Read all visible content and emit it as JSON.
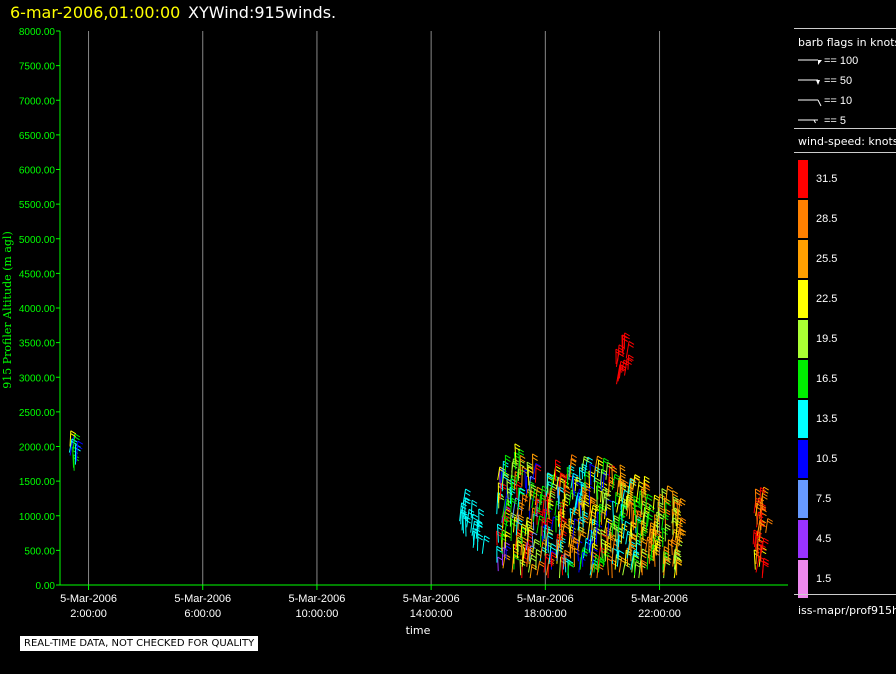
{
  "title": {
    "date": "6-mar-2006,01:00:00",
    "main": "XYWind:915winds."
  },
  "footer": {
    "quality_notice": "REAL-TIME DATA, NOT CHECKED FOR QUALITY",
    "source": "iss-mapr/prof915h"
  },
  "legend": {
    "barb_title": "barb flags in knots",
    "barbs": [
      {
        "label": "== 100",
        "kind": "flag-100"
      },
      {
        "label": "== 50",
        "kind": "flag-50"
      },
      {
        "label": "== 10",
        "kind": "barb-10"
      },
      {
        "label": "== 5",
        "kind": "barb-5"
      }
    ],
    "speed_title": "wind-speed: knots",
    "speed_scale": [
      {
        "label": "31.5",
        "color": "#ff0000"
      },
      {
        "label": "28.5",
        "color": "#ff8000"
      },
      {
        "label": "25.5",
        "color": "#ff9f00"
      },
      {
        "label": "22.5",
        "color": "#ffff00"
      },
      {
        "label": "19.5",
        "color": "#aaff33"
      },
      {
        "label": "16.5",
        "color": "#00ee00"
      },
      {
        "label": "13.5",
        "color": "#00ffff"
      },
      {
        "label": "10.5",
        "color": "#0000ff"
      },
      {
        "label": "7.5",
        "color": "#6699ff"
      },
      {
        "label": "4.5",
        "color": "#9933ff"
      },
      {
        "label": "1.5",
        "color": "#ee88ee"
      }
    ]
  },
  "colors": {
    "axis": "#00ff00",
    "grid": "#888888",
    "background": "#000000"
  },
  "chart_data": {
    "type": "scatter",
    "xlabel": "time",
    "ylabel": "915 Profiler Altitude (m agl)",
    "xlim_hours": [
      1.0,
      26.5
    ],
    "ylim": [
      0,
      8000
    ],
    "y_ticks": [
      "0.00",
      "500.00",
      "1000.00",
      "1500.00",
      "2000.00",
      "2500.00",
      "3000.00",
      "3500.00",
      "4000.00",
      "4500.00",
      "5000.00",
      "5500.00",
      "6000.00",
      "6500.00",
      "7000.00",
      "7500.00",
      "8000.00"
    ],
    "x_ticks": [
      {
        "hour": 2,
        "date": "5-Mar-2006",
        "time": "2:00:00"
      },
      {
        "hour": 6,
        "date": "5-Mar-2006",
        "time": "6:00:00"
      },
      {
        "hour": 10,
        "date": "5-Mar-2006",
        "time": "10:00:00"
      },
      {
        "hour": 14,
        "date": "5-Mar-2006",
        "time": "14:00:00"
      },
      {
        "hour": 18,
        "date": "5-Mar-2006",
        "time": "18:00:00"
      },
      {
        "hour": 22,
        "date": "5-Mar-2006",
        "time": "22:00:00"
      }
    ],
    "grid": true,
    "series": [
      {
        "time_hours": 1.5,
        "alt_range": [
          1650,
          2000
        ],
        "speeds": [
          10,
          12,
          14,
          16,
          20,
          23
        ]
      },
      {
        "time_hours": 15.2,
        "alt_range": [
          700,
          1100
        ],
        "speeds": [
          13,
          14
        ]
      },
      {
        "time_hours": 15.6,
        "alt_range": [
          450,
          800
        ],
        "speeds": [
          13,
          14
        ]
      },
      {
        "time_hours": 16.5,
        "alt_range": [
          200,
          1600
        ],
        "speeds": [
          5,
          10,
          13,
          17,
          20,
          23,
          26,
          30
        ]
      },
      {
        "time_hours": 17.0,
        "alt_range": [
          100,
          1750
        ],
        "speeds": [
          8,
          13,
          16,
          19,
          22,
          26,
          29,
          32
        ]
      },
      {
        "time_hours": 17.5,
        "alt_range": [
          100,
          1600
        ],
        "speeds": [
          8,
          11,
          15,
          19,
          22,
          25,
          28,
          32
        ]
      },
      {
        "time_hours": 18.0,
        "alt_range": [
          100,
          1400
        ],
        "speeds": [
          11,
          14,
          17,
          20,
          23,
          27,
          30
        ]
      },
      {
        "time_hours": 18.5,
        "alt_range": [
          100,
          1500
        ],
        "speeds": [
          8,
          13,
          16,
          19,
          22,
          26,
          29,
          32
        ]
      },
      {
        "time_hours": 19.0,
        "alt_range": [
          100,
          1600
        ],
        "speeds": [
          11,
          14,
          17,
          20,
          23,
          26,
          29
        ]
      },
      {
        "time_hours": 19.5,
        "alt_range": [
          100,
          1650
        ],
        "speeds": [
          9,
          14,
          17,
          20,
          23,
          25,
          28
        ]
      },
      {
        "time_hours": 20.0,
        "alt_range": [
          100,
          1600
        ],
        "speeds": [
          11,
          15,
          18,
          21,
          24,
          27,
          30
        ]
      },
      {
        "time_hours": 20.5,
        "alt_range": [
          100,
          1500
        ],
        "speeds": [
          12,
          15,
          18,
          21,
          24,
          27
        ]
      },
      {
        "time_hours": 21.0,
        "alt_range": [
          100,
          1400
        ],
        "speeds": [
          14,
          17,
          20,
          23,
          26,
          29
        ]
      },
      {
        "time_hours": 21.5,
        "alt_range": [
          100,
          1300
        ],
        "speeds": [
          15,
          18,
          21,
          24,
          27
        ]
      },
      {
        "time_hours": 22.0,
        "alt_range": [
          100,
          1200
        ],
        "speeds": [
          16,
          19,
          22,
          25,
          28
        ]
      },
      {
        "time_hours": 22.5,
        "alt_range": [
          100,
          1100
        ],
        "speeds": [
          18,
          21,
          24,
          27
        ]
      },
      {
        "time_hours": 20.7,
        "alt_range": [
          2900,
          3400
        ],
        "speeds": [
          31,
          32,
          33
        ]
      },
      {
        "time_hours": 25.5,
        "alt_range": [
          100,
          1200
        ],
        "speeds": [
          22,
          25,
          28,
          31,
          33
        ]
      }
    ]
  }
}
